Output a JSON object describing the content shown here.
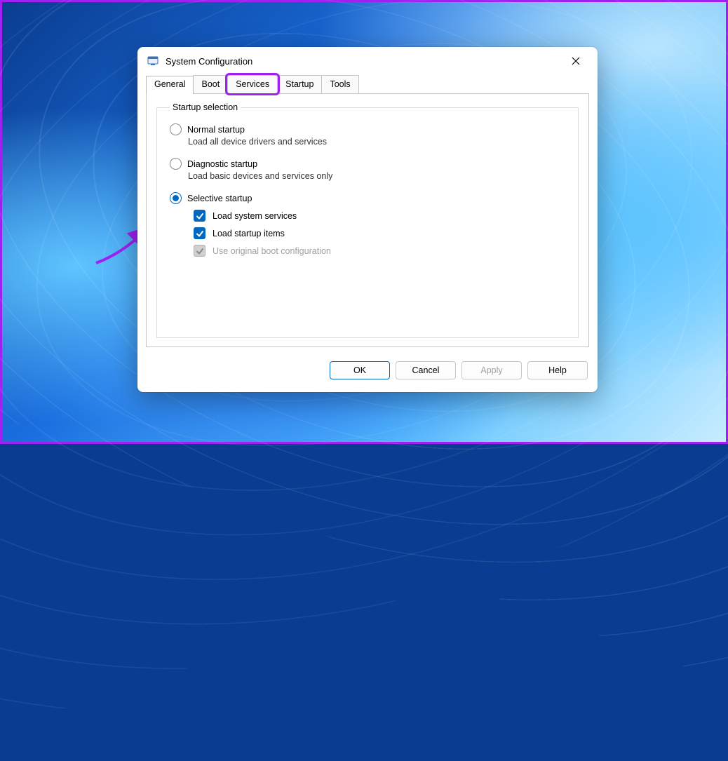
{
  "window": {
    "title": "System Configuration"
  },
  "tabs": {
    "general": "General",
    "boot": "Boot",
    "services": "Services",
    "startup": "Startup",
    "tools": "Tools"
  },
  "group": {
    "legend": "Startup selection",
    "normal": {
      "label": "Normal startup",
      "desc": "Load all device drivers and services"
    },
    "diagnostic": {
      "label": "Diagnostic startup",
      "desc": "Load basic devices and services only"
    },
    "selective": {
      "label": "Selective startup",
      "load_services": "Load system services",
      "load_startup": "Load startup items",
      "use_original": "Use original boot configuration"
    }
  },
  "buttons": {
    "ok": "OK",
    "cancel": "Cancel",
    "apply": "Apply",
    "help": "Help"
  }
}
